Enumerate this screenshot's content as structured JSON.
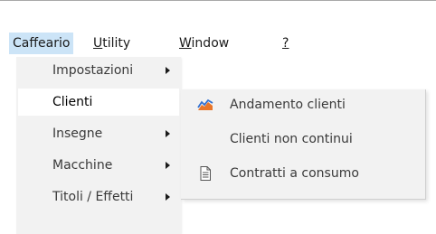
{
  "menubar": {
    "items": [
      {
        "label": "Caffeario",
        "active": true
      },
      {
        "label": "Utility",
        "mnemonic": "U"
      },
      {
        "label": "Window",
        "mnemonic": "W"
      },
      {
        "label": "?"
      }
    ]
  },
  "dropdown": {
    "items": [
      {
        "label": "Impostazioni",
        "has_submenu": true
      },
      {
        "label": "Clienti",
        "has_submenu": false,
        "highlighted": true
      },
      {
        "label": "Insegne",
        "has_submenu": true
      },
      {
        "label": "Macchine",
        "has_submenu": true
      },
      {
        "label": "Titoli / Effetti",
        "has_submenu": true
      }
    ]
  },
  "submenu": {
    "items": [
      {
        "label": "Andamento clienti",
        "icon": "trend-chart-icon"
      },
      {
        "label": "Clienti non continui",
        "icon": ""
      },
      {
        "label": "Contratti a consumo",
        "icon": "document-icon"
      }
    ]
  },
  "colors": {
    "menu_background": "#f2f2f2",
    "active_menubar": "#cce4f7",
    "highlight": "#ffffff",
    "chart_blue": "#2f6fd1",
    "chart_orange": "#e8762b"
  }
}
